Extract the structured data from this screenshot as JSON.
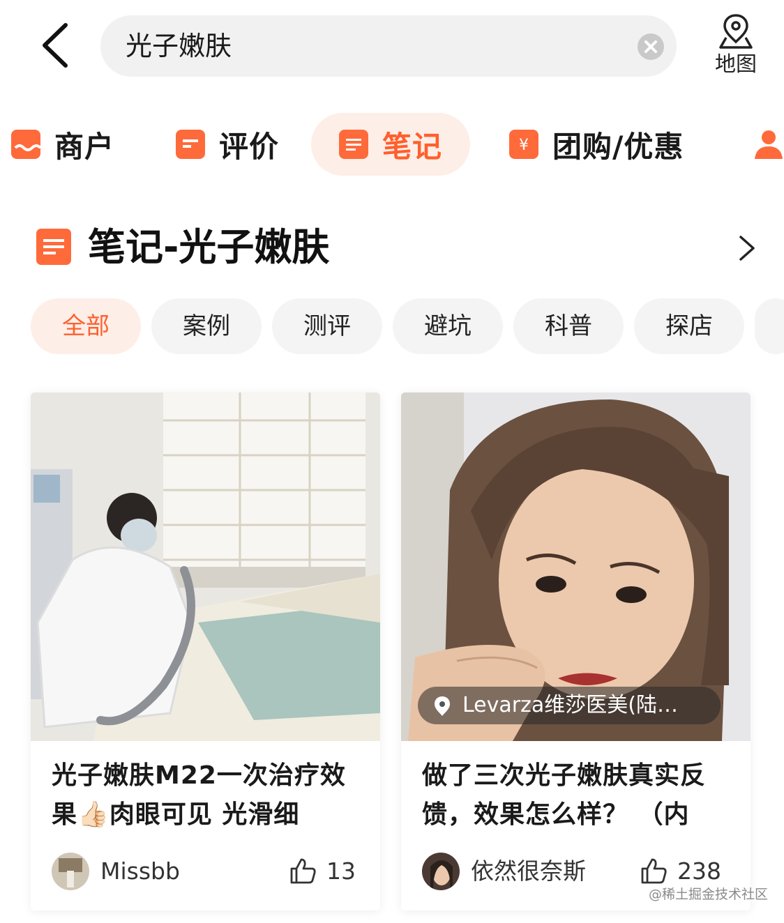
{
  "search": {
    "query": "光子嫩肤"
  },
  "map": {
    "label": "地图"
  },
  "categories": [
    {
      "label": "商户",
      "icon": "shop-icon"
    },
    {
      "label": "评价",
      "icon": "comment-icon"
    },
    {
      "label": "笔记",
      "icon": "note-icon",
      "active": true
    },
    {
      "label": "团购/优惠",
      "icon": "coupon-icon"
    },
    {
      "label": "",
      "icon": "user-icon"
    }
  ],
  "section": {
    "title": "笔记-光子嫩肤"
  },
  "filters": [
    {
      "label": "全部",
      "active": true
    },
    {
      "label": "案例"
    },
    {
      "label": "测评"
    },
    {
      "label": "避坑"
    },
    {
      "label": "科普"
    },
    {
      "label": "探店"
    }
  ],
  "notes": [
    {
      "title": "光子嫩肤M22一次治疗效果👍🏻肉眼可见 光滑细",
      "author": "Missbb",
      "likes": "13"
    },
    {
      "title": "做了三次光子嫩肤真实反馈，效果怎么样？ （内",
      "author": "依然很奈斯",
      "likes": "238",
      "location": "Levarza维莎医美(陆…"
    }
  ],
  "watermark": "@稀土掘金技术社区",
  "colors": {
    "accent": "#ff5f2d",
    "accent_bg": "#fdeee7",
    "chip_bg": "#f4f4f4"
  }
}
